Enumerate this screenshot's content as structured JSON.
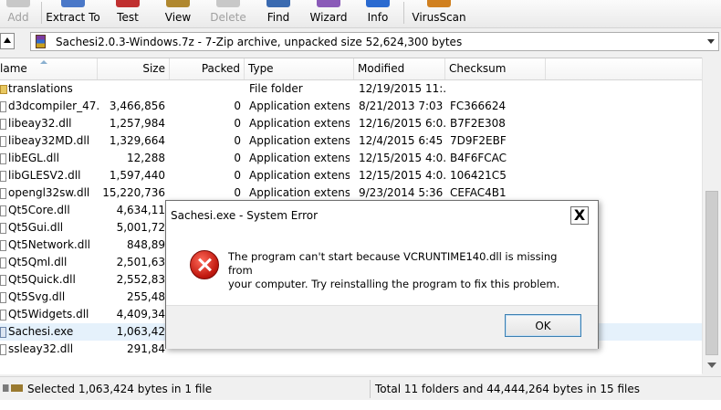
{
  "toolbar": {
    "buttons": [
      {
        "label": "Add",
        "disabled": true,
        "icon": "add-icon"
      },
      {
        "label": "Extract To",
        "disabled": false,
        "icon": "extract-icon"
      },
      {
        "label": "Test",
        "disabled": false,
        "icon": "test-icon"
      },
      {
        "label": "View",
        "disabled": false,
        "icon": "view-icon"
      },
      {
        "label": "Delete",
        "disabled": true,
        "icon": "delete-icon"
      },
      {
        "label": "Find",
        "disabled": false,
        "icon": "find-icon"
      },
      {
        "label": "Wizard",
        "disabled": false,
        "icon": "wizard-icon"
      },
      {
        "label": "Info",
        "disabled": false,
        "icon": "info-icon"
      },
      {
        "label": "VirusScan",
        "disabled": false,
        "icon": "virusscan-icon"
      }
    ]
  },
  "address": {
    "text": "Sachesi2.0.3-Windows.7z - 7-Zip archive, unpacked size 52,624,300 bytes"
  },
  "columns": {
    "name": "lame",
    "size": "Size",
    "packed": "Packed",
    "type": "Type",
    "modified": "Modified",
    "checksum": "Checksum"
  },
  "files": [
    {
      "name": "translations",
      "size": "",
      "packed": "",
      "type": "File folder",
      "modified": "12/19/2015 11:...",
      "checksum": "",
      "kind": "folder"
    },
    {
      "name": "d3dcompiler_47....",
      "size": "3,466,856",
      "packed": "0",
      "type": "Application extens...",
      "modified": "8/21/2013 7:03 ...",
      "checksum": "FC366624",
      "kind": "dll"
    },
    {
      "name": "libeay32.dll",
      "size": "1,257,984",
      "packed": "0",
      "type": "Application extens...",
      "modified": "12/16/2015 6:0...",
      "checksum": "B7F2E308",
      "kind": "dll"
    },
    {
      "name": "libeay32MD.dll",
      "size": "1,329,664",
      "packed": "0",
      "type": "Application extens...",
      "modified": "12/4/2015 6:45 ...",
      "checksum": "7D9F2EBF",
      "kind": "dll"
    },
    {
      "name": "libEGL.dll",
      "size": "12,288",
      "packed": "0",
      "type": "Application extens...",
      "modified": "12/15/2015 4:0...",
      "checksum": "B4F6FCAC",
      "kind": "dll"
    },
    {
      "name": "libGLESV2.dll",
      "size": "1,597,440",
      "packed": "0",
      "type": "Application extens...",
      "modified": "12/15/2015 4:0...",
      "checksum": "106421C5",
      "kind": "dll"
    },
    {
      "name": "opengl32sw.dll",
      "size": "15,220,736",
      "packed": "0",
      "type": "Application extens...",
      "modified": "9/23/2014 5:36 ...",
      "checksum": "CEFAC4B1",
      "kind": "dll"
    },
    {
      "name": "Qt5Core.dll",
      "size": "4,634,11",
      "packed": "",
      "type": "",
      "modified": "",
      "checksum": "",
      "kind": "dll"
    },
    {
      "name": "Qt5Gui.dll",
      "size": "5,001,72",
      "packed": "",
      "type": "",
      "modified": "",
      "checksum": "",
      "kind": "dll"
    },
    {
      "name": "Qt5Network.dll",
      "size": "848,89",
      "packed": "",
      "type": "",
      "modified": "",
      "checksum": "",
      "kind": "dll"
    },
    {
      "name": "Qt5Qml.dll",
      "size": "2,501,63",
      "packed": "",
      "type": "",
      "modified": "",
      "checksum": "",
      "kind": "dll"
    },
    {
      "name": "Qt5Quick.dll",
      "size": "2,552,83",
      "packed": "",
      "type": "",
      "modified": "",
      "checksum": "",
      "kind": "dll"
    },
    {
      "name": "Qt5Svg.dll",
      "size": "255,48",
      "packed": "",
      "type": "",
      "modified": "",
      "checksum": "",
      "kind": "dll"
    },
    {
      "name": "Qt5Widgets.dll",
      "size": "4,409,34",
      "packed": "",
      "type": "",
      "modified": "",
      "checksum": "",
      "kind": "dll"
    },
    {
      "name": "Sachesi.exe",
      "size": "1,063,42",
      "packed": "",
      "type": "",
      "modified": "",
      "checksum": "",
      "kind": "exe",
      "selected": true
    },
    {
      "name": "ssleay32.dll",
      "size": "291,84",
      "packed": "",
      "type": "",
      "modified": "",
      "checksum": "",
      "kind": "dll"
    }
  ],
  "status": {
    "left": "Selected 1,063,424 bytes in 1 file",
    "right": "Total 11 folders and 44,444,264 bytes in 15 files"
  },
  "dialog": {
    "title": "Sachesi.exe - System Error",
    "close_label": "X",
    "message_line1": "The program can't start because VCRUNTIME140.dll is missing from",
    "message_line2": "your computer. Try reinstalling the program to fix this problem.",
    "ok_label": "OK"
  }
}
